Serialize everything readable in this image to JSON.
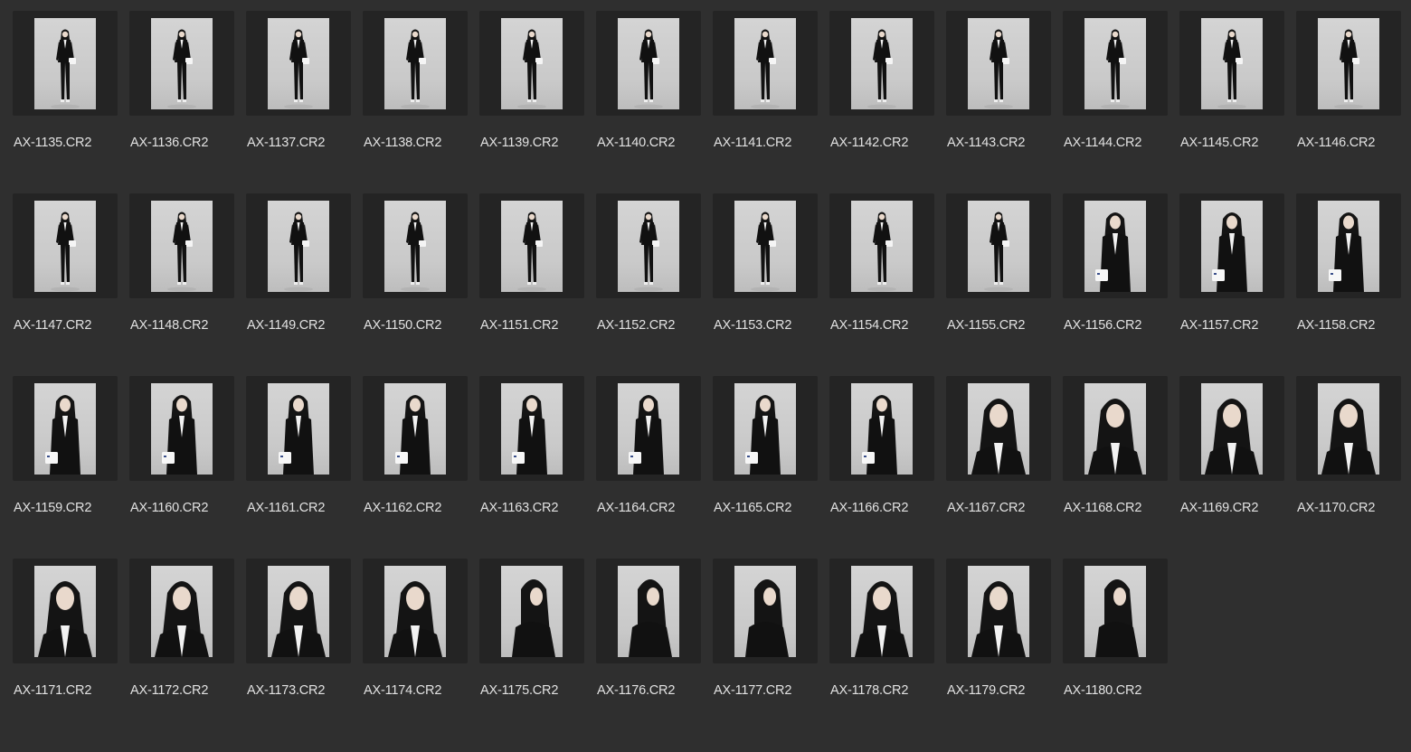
{
  "colors": {
    "background": "#2f2f2f",
    "thumb_frame": "#242424",
    "photo_backdrop": "#cfcfcf",
    "label_text": "#e2e2e2"
  },
  "files": [
    {
      "name": "AX-1135.CR2",
      "shot": "full"
    },
    {
      "name": "AX-1136.CR2",
      "shot": "full"
    },
    {
      "name": "AX-1137.CR2",
      "shot": "full"
    },
    {
      "name": "AX-1138.CR2",
      "shot": "full"
    },
    {
      "name": "AX-1139.CR2",
      "shot": "full"
    },
    {
      "name": "AX-1140.CR2",
      "shot": "full"
    },
    {
      "name": "AX-1141.CR2",
      "shot": "full"
    },
    {
      "name": "AX-1142.CR2",
      "shot": "full"
    },
    {
      "name": "AX-1143.CR2",
      "shot": "full"
    },
    {
      "name": "AX-1144.CR2",
      "shot": "full"
    },
    {
      "name": "AX-1145.CR2",
      "shot": "full"
    },
    {
      "name": "AX-1146.CR2",
      "shot": "full"
    },
    {
      "name": "AX-1147.CR2",
      "shot": "full"
    },
    {
      "name": "AX-1148.CR2",
      "shot": "full"
    },
    {
      "name": "AX-1149.CR2",
      "shot": "full"
    },
    {
      "name": "AX-1150.CR2",
      "shot": "full"
    },
    {
      "name": "AX-1151.CR2",
      "shot": "full"
    },
    {
      "name": "AX-1152.CR2",
      "shot": "full"
    },
    {
      "name": "AX-1153.CR2",
      "shot": "full"
    },
    {
      "name": "AX-1154.CR2",
      "shot": "full"
    },
    {
      "name": "AX-1155.CR2",
      "shot": "full"
    },
    {
      "name": "AX-1156.CR2",
      "shot": "medium"
    },
    {
      "name": "AX-1157.CR2",
      "shot": "medium"
    },
    {
      "name": "AX-1158.CR2",
      "shot": "medium"
    },
    {
      "name": "AX-1159.CR2",
      "shot": "medium"
    },
    {
      "name": "AX-1160.CR2",
      "shot": "medium"
    },
    {
      "name": "AX-1161.CR2",
      "shot": "medium"
    },
    {
      "name": "AX-1162.CR2",
      "shot": "medium"
    },
    {
      "name": "AX-1163.CR2",
      "shot": "medium"
    },
    {
      "name": "AX-1164.CR2",
      "shot": "medium"
    },
    {
      "name": "AX-1165.CR2",
      "shot": "medium"
    },
    {
      "name": "AX-1166.CR2",
      "shot": "medium"
    },
    {
      "name": "AX-1167.CR2",
      "shot": "portrait"
    },
    {
      "name": "AX-1168.CR2",
      "shot": "portrait"
    },
    {
      "name": "AX-1169.CR2",
      "shot": "portrait"
    },
    {
      "name": "AX-1170.CR2",
      "shot": "portrait"
    },
    {
      "name": "AX-1171.CR2",
      "shot": "portrait"
    },
    {
      "name": "AX-1172.CR2",
      "shot": "portrait"
    },
    {
      "name": "AX-1173.CR2",
      "shot": "portrait"
    },
    {
      "name": "AX-1174.CR2",
      "shot": "portrait"
    },
    {
      "name": "AX-1175.CR2",
      "shot": "profile"
    },
    {
      "name": "AX-1176.CR2",
      "shot": "profile"
    },
    {
      "name": "AX-1177.CR2",
      "shot": "profile"
    },
    {
      "name": "AX-1178.CR2",
      "shot": "portrait"
    },
    {
      "name": "AX-1179.CR2",
      "shot": "portrait"
    },
    {
      "name": "AX-1180.CR2",
      "shot": "profile"
    }
  ]
}
